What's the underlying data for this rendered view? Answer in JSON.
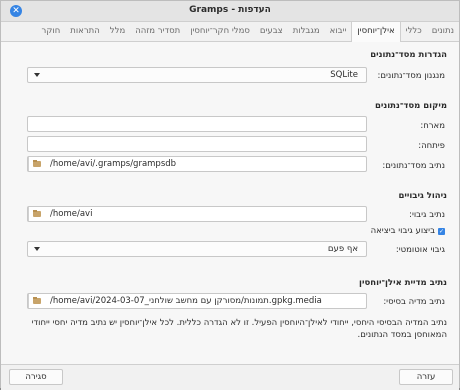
{
  "window": {
    "title": "Gramps - העדפות"
  },
  "tabs": [
    "נתונים",
    "כללי",
    "אילן־יוחסין",
    "ייבוא",
    "מגבלות",
    "צבעים",
    "סמלי חקר־יוחסין",
    "תסדיר מזהה",
    "מלל",
    "התראות",
    "חוקר"
  ],
  "sections": {
    "db_settings": {
      "title": "הגדרות מסד־נתונים",
      "backend_label": "מנגנון מסד־נתונים:",
      "backend_value": "SQLite"
    },
    "db_location": {
      "title": "מיקום מסד־נתונים",
      "host_label": "מארח:",
      "host_value": "",
      "port_label": "פיתחה:",
      "port_value": "",
      "path_label": "נתיב מסד־נתונים:",
      "path_value": "/home/avi/.gramps/grampsdb"
    },
    "backup": {
      "title": "ניהול גיבויים",
      "path_label": "נתיב גיבוי:",
      "path_value": "/home/avi",
      "on_exit_label": "ביצוע גיבוי ביציאה",
      "on_exit_checked": true,
      "auto_label": "גיבוי אוטומטי:",
      "auto_value": "אף פעם"
    },
    "media": {
      "title": "נתיב מדיית אילן־יוחסין",
      "base_label": "נתיב מדיה בסיסי:",
      "base_value": "/home/avi/2024-03-07_תמונות/מסורקן עם מחשב שולחני.gpkg.media",
      "description": "נתיב המדיה הבסיסי היחסי, ייחודי לאילן־היוחסין הפעיל. זו לא הגדרה כללית. לכל אילן־יוחסין יש נתיב מדיה יחסי ייחודי המאוחסן במסד הנתונים."
    }
  },
  "buttons": {
    "close": "סגירה",
    "help": "עזרה"
  }
}
